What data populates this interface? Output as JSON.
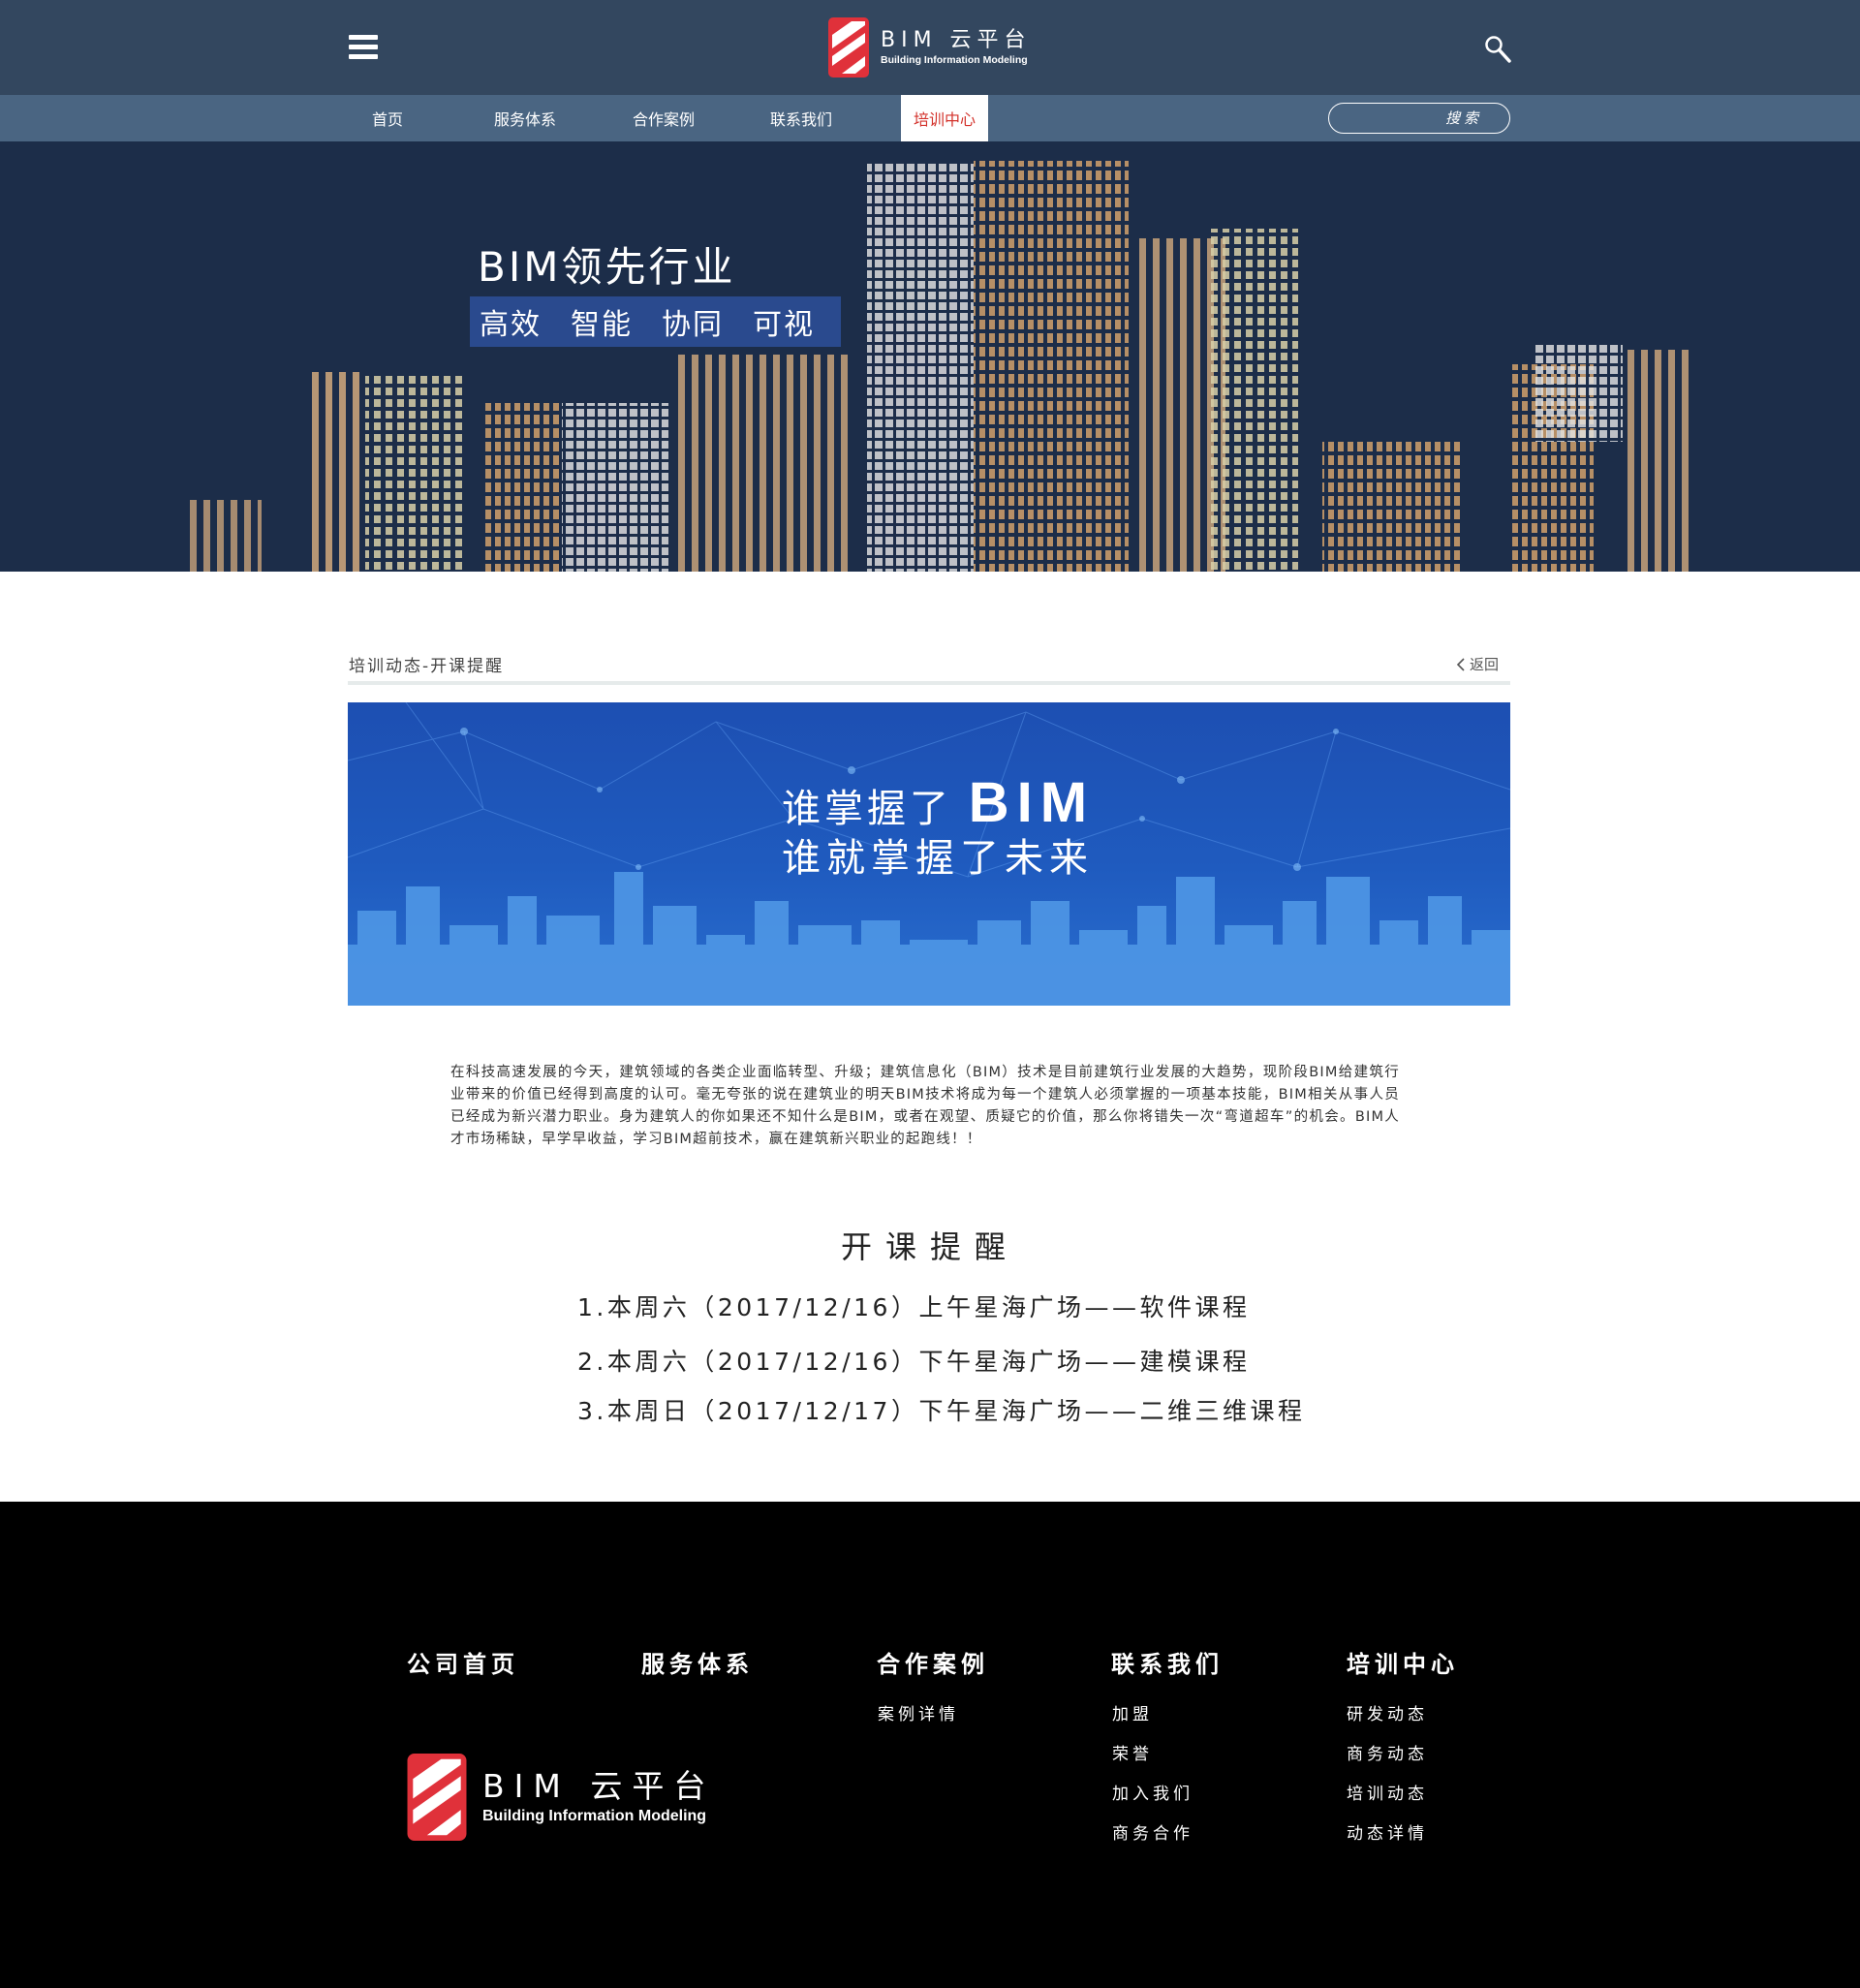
{
  "header": {
    "logo_main": "BIM 云平台",
    "logo_sub": "Building Information Modeling"
  },
  "nav": {
    "items": [
      "首页",
      "服务体系",
      "合作案例",
      "联系我们",
      "培训中心"
    ],
    "active": "培训中心",
    "search_placeholder": "搜索"
  },
  "hero": {
    "title": "BIM领先行业",
    "tags": [
      "高效",
      "智能",
      "协同",
      "可视"
    ]
  },
  "article": {
    "breadcrumb": "培训动态-开课提醒",
    "back_label": "返回",
    "banner_line1_prefix": "谁掌握了",
    "banner_line1_bim": "BIM",
    "banner_line2": "谁就掌握了未来",
    "intro": "在科技高速发展的今天，建筑领域的各类企业面临转型、升级；建筑信息化（BIM）技术是目前建筑行业发展的大趋势，现阶段BIM给建筑行业带来的价值已经得到高度的认可。毫无夸张的说在建筑业的明天BIM技术将成为每一个建筑人必须掌握的一项基本技能，BIM相关从事人员已经成为新兴潜力职业。身为建筑人的你如果还不知什么是BIM，或者在观望、质疑它的价值，那么你将错失一次“弯道超车”的机会。BIM人才市场稀缺，早学早收益，学习BIM超前技术，赢在建筑新兴职业的起跑线！！",
    "course_title": "开课提醒",
    "courses": [
      "1.本周六（2017/12/16）上午星海广场——软件课程",
      "2.本周六（2017/12/16）下午星海广场——建模课程",
      "3.本周日（2017/12/17）下午星海广场——二维三维课程"
    ]
  },
  "footer": {
    "columns": [
      {
        "title": "公司首页",
        "items": []
      },
      {
        "title": "服务体系",
        "items": []
      },
      {
        "title": "合作案例",
        "items": [
          "案例详情"
        ]
      },
      {
        "title": "联系我们",
        "items": [
          "加盟",
          "荣誉",
          "加入我们",
          "商务合作"
        ]
      },
      {
        "title": "培训中心",
        "items": [
          "研发动态",
          "商务动态",
          "培训动态",
          "动态详情"
        ]
      }
    ],
    "logo_main": "BIM 云平台",
    "logo_sub": "Building Information Modeling"
  },
  "colors": {
    "header_bg": "#33475f",
    "nav_bg": "#4a6582",
    "hero_bg": "#1c2d49",
    "accent_red": "#d3322b",
    "footer_bg": "#000000"
  }
}
